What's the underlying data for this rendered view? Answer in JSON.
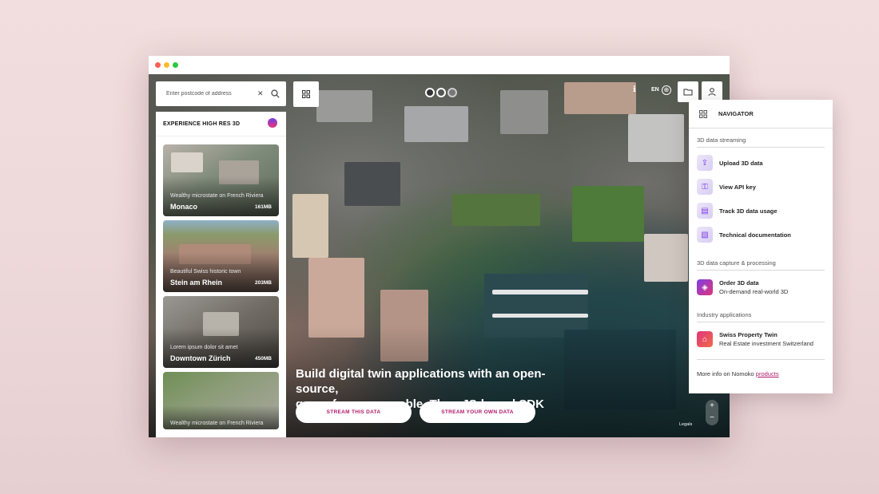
{
  "search": {
    "placeholder": "Enter postcode of address"
  },
  "sidebar": {
    "title": "EXPERIENCE HIGH RES 3D",
    "cards": [
      {
        "subtitle": "Wealthy microstate on French Riviera",
        "name": "Monaco",
        "size": "161MB"
      },
      {
        "subtitle": "Beautiful Swiss historic town",
        "name": "Stein am Rhein",
        "size": "203MB"
      },
      {
        "subtitle": "Lorem ipsum dolor sit amet",
        "name": "Downtown Zürich",
        "size": "450MB"
      },
      {
        "subtitle": "Wealthy microstate on French Riviera",
        "name": "",
        "size": ""
      }
    ]
  },
  "topbar": {
    "language": "EN"
  },
  "hero": {
    "headline_line1": "Build digital twin applications with an open-source,",
    "headline_line2": "geo-reference capable, ThreeJS-based SDK",
    "btn_stream_this": "STREAM THIS DATA",
    "btn_stream_own": "STREAM YOUR OWN DATA"
  },
  "map": {
    "legals": "Legals",
    "zoom_in": "+",
    "zoom_out": "−"
  },
  "navigator": {
    "title": "NAVIGATOR",
    "sections": [
      {
        "label": "3D data streaming",
        "items": [
          "Upload 3D data",
          "View API key",
          "Track 3D data usage",
          "Technical documentation"
        ]
      },
      {
        "label": "3D data capture & processing",
        "items": [
          {
            "title": "Order 3D data",
            "desc": "On-demand real-world 3D"
          }
        ]
      },
      {
        "label": "Industry applications",
        "items": [
          {
            "title": "Swiss Property Twin",
            "desc": "Real Estate investment Switzerland"
          }
        ]
      }
    ],
    "footer_text": "More info on Nomoko",
    "footer_link": "products"
  },
  "colors": {
    "accent": "#b0196a",
    "brand_gradient": [
      "#7b3fe4",
      "#e0357a"
    ]
  }
}
